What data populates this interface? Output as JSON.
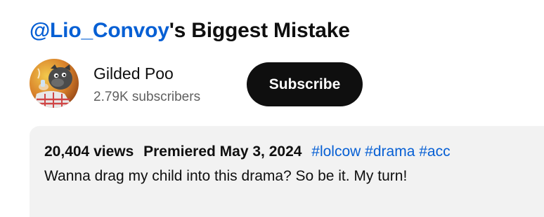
{
  "video": {
    "title_mention": "@Lio_Convoy",
    "title_rest": "'s Biggest Mistake"
  },
  "channel": {
    "name": "Gilded Poo",
    "subscribers": "2.79K subscribers",
    "subscribe_label": "Subscribe",
    "avatar_icon": "cartoon-character-avatar"
  },
  "description": {
    "views": "20,404 views",
    "premiered": "Premiered May 3, 2024",
    "hashtags": [
      "#lolcow",
      "#drama",
      "#acc"
    ],
    "text": "Wanna drag my child into this drama? So be it. My turn!"
  },
  "colors": {
    "link": "#065fd4",
    "button_bg": "#0f0f0f",
    "button_text": "#ffffff",
    "secondary_text": "#606060",
    "description_bg": "#f2f2f2"
  }
}
